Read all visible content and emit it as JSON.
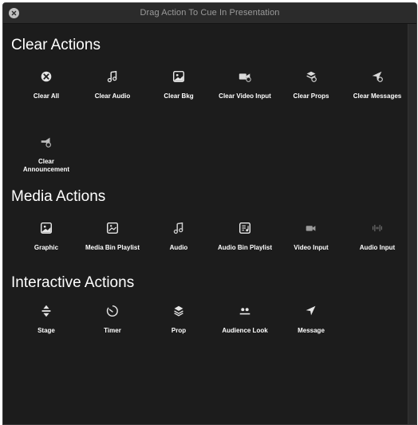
{
  "window": {
    "title": "Drag Action To Cue In Presentation"
  },
  "sections": {
    "clear": {
      "title": "Clear Actions",
      "items": [
        {
          "label": "Clear All",
          "icon": "clear-all-icon"
        },
        {
          "label": "Clear Audio",
          "icon": "music-note-icon"
        },
        {
          "label": "Clear Bkg",
          "icon": "image-icon"
        },
        {
          "label": "Clear Video Input",
          "icon": "video-input-icon"
        },
        {
          "label": "Clear Props",
          "icon": "props-icon"
        },
        {
          "label": "Clear Messages",
          "icon": "message-icon"
        },
        {
          "label": "Clear Announcement",
          "icon": "announcement-icon"
        }
      ]
    },
    "media": {
      "title": "Media Actions",
      "items": [
        {
          "label": "Graphic",
          "icon": "graphic-icon"
        },
        {
          "label": "Media Bin Playlist",
          "icon": "media-bin-playlist-icon"
        },
        {
          "label": "Audio",
          "icon": "music-note-icon"
        },
        {
          "label": "Audio Bin Playlist",
          "icon": "audio-bin-playlist-icon"
        },
        {
          "label": "Video Input",
          "icon": "video-camera-icon"
        },
        {
          "label": "Audio Input",
          "icon": "audio-input-icon"
        }
      ]
    },
    "interactive": {
      "title": "Interactive Actions",
      "items": [
        {
          "label": "Stage",
          "icon": "stage-icon"
        },
        {
          "label": "Timer",
          "icon": "timer-icon"
        },
        {
          "label": "Prop",
          "icon": "prop-icon"
        },
        {
          "label": "Audience Look",
          "icon": "audience-look-icon"
        },
        {
          "label": "Message",
          "icon": "message-arrow-icon"
        }
      ]
    }
  }
}
